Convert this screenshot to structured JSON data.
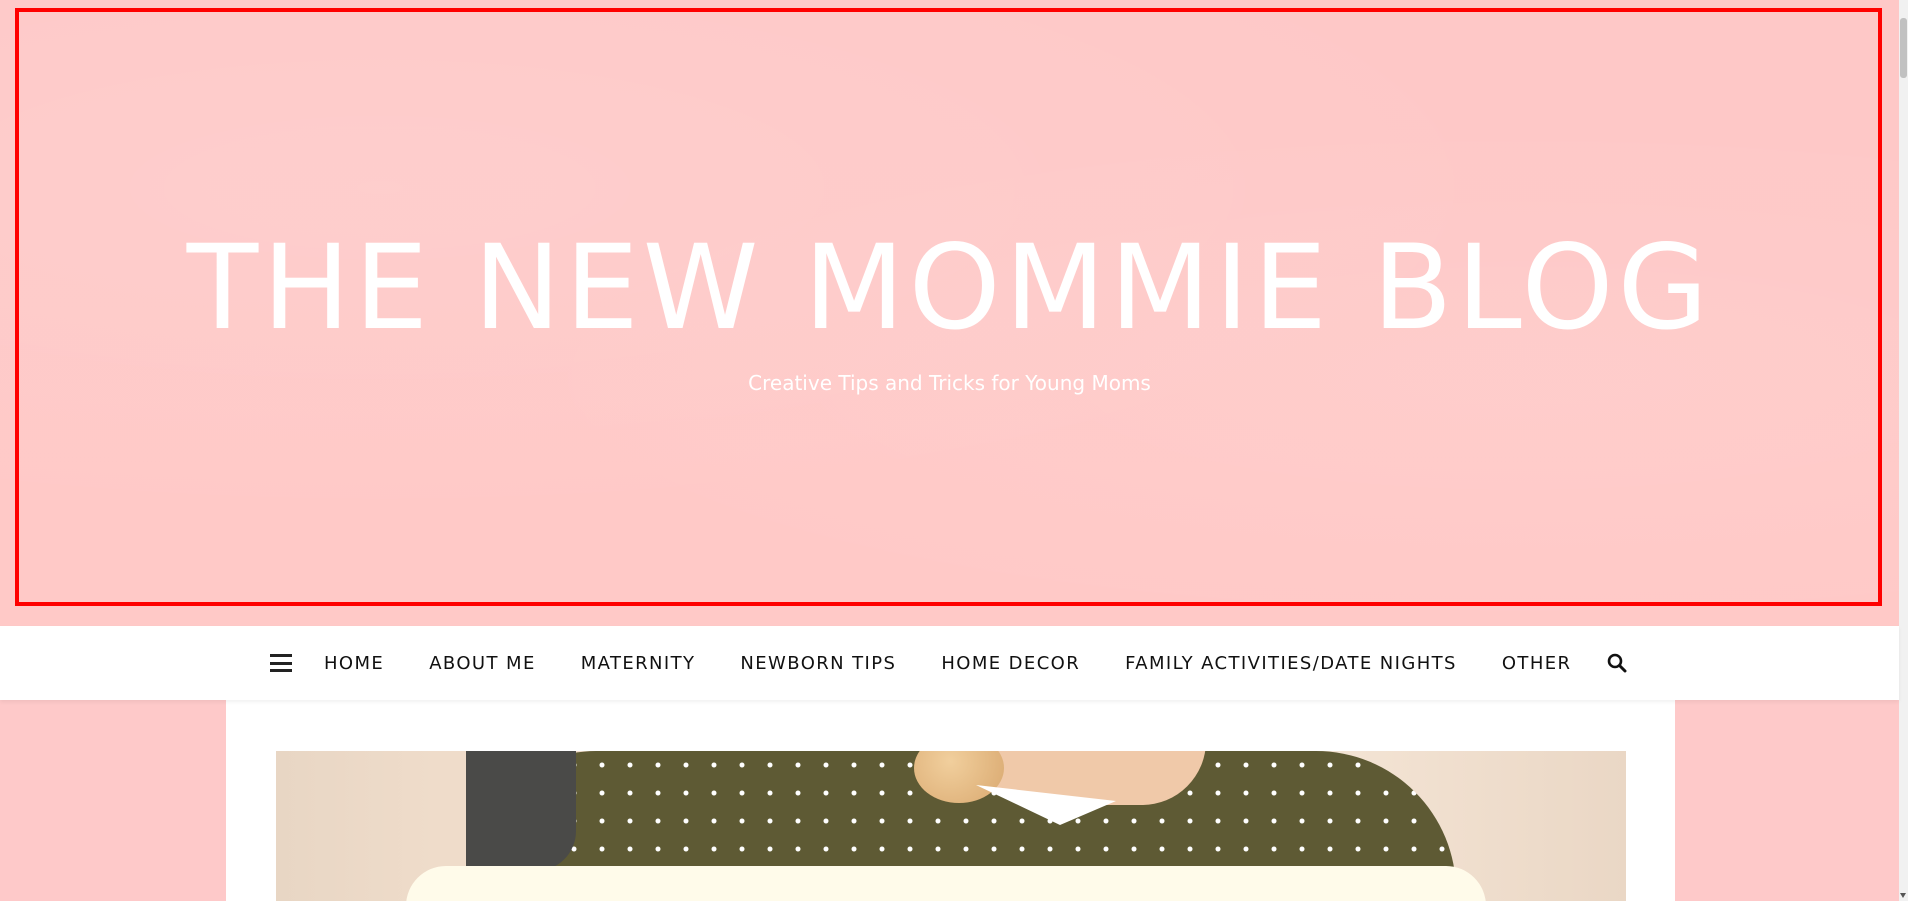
{
  "header": {
    "title": "THE NEW MOMMIE BLOG",
    "tagline": "Creative Tips and Tricks for Young Moms",
    "background_color": "#fec9c9",
    "highlight_color": "#ff0000"
  },
  "nav": {
    "menu_icon": "hamburger-menu-icon",
    "items": [
      {
        "label": "HOME"
      },
      {
        "label": "ABOUT ME"
      },
      {
        "label": "MATERNITY"
      },
      {
        "label": "NEWBORN TIPS"
      },
      {
        "label": "HOME DECOR"
      },
      {
        "label": "FAMILY ACTIVITIES/DATE NIGHTS"
      },
      {
        "label": "OTHER"
      }
    ],
    "search_icon": "search-icon"
  },
  "featured_post": {
    "image_overlay_color": "#3f78b0"
  },
  "colors": {
    "page_background": "#fec9c9",
    "nav_background": "#ffffff",
    "text_dark": "#111111"
  }
}
